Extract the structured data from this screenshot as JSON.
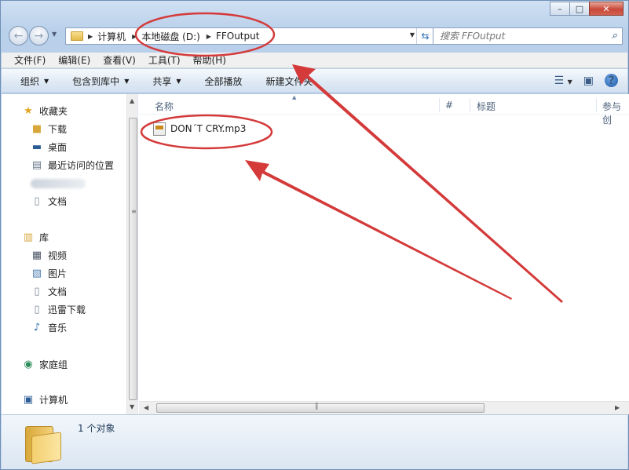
{
  "address": {
    "crumbs": [
      "计算机",
      "本地磁盘 (D:)",
      "FFOutput"
    ]
  },
  "search": {
    "placeholder": "搜索 FFOutput"
  },
  "menubar": {
    "items": [
      "文件(F)",
      "编辑(E)",
      "查看(V)",
      "工具(T)",
      "帮助(H)"
    ]
  },
  "commandbar": {
    "organize": "组织",
    "include_in_library": "包含到库中",
    "share": "共享",
    "play_all": "全部播放",
    "new_folder": "新建文件夹"
  },
  "nav": {
    "favorites": "收藏夹",
    "downloads": "下载",
    "desktop": "桌面",
    "recent_places": "最近访问的位置",
    "documents_fav": "文档",
    "libraries": "库",
    "videos": "视频",
    "pictures": "图片",
    "documents": "文档",
    "xunlei_downloads": "迅雷下载",
    "music": "音乐",
    "homegroup": "家庭组",
    "computer": "计算机"
  },
  "columns": {
    "name": "名称",
    "number": "#",
    "title": "标题",
    "contributing_artists": "参与创"
  },
  "files": [
    {
      "name": "DON´T CRY.mp3"
    }
  ],
  "details": {
    "item_count": "1 个对象"
  },
  "annotation": {
    "color": "#d43a3a"
  }
}
